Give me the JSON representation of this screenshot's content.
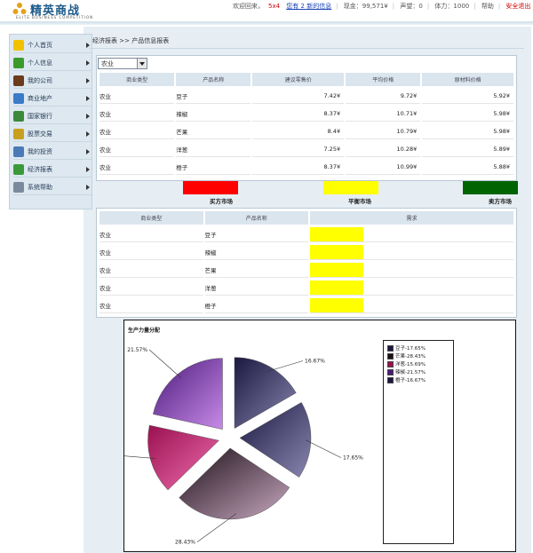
{
  "header": {
    "logo_text": "精英商战",
    "logo_sub": "ELITE BUSINESS COMPETITION",
    "welcome": "欢迎回来，",
    "username": "5x4",
    "messages": "您有 2 新的信息",
    "cash": "现金：99,571¥",
    "reputation": "声望：0",
    "stamina": "体力：1000",
    "help": "帮助",
    "logout": "安全退出"
  },
  "sidebar": {
    "items": [
      {
        "label": "个人首页",
        "icon": "smiley-icon",
        "color": "#f2c200"
      },
      {
        "label": "个人信息",
        "icon": "user-icon",
        "color": "#3a9a2a"
      },
      {
        "label": "我的公司",
        "icon": "door-icon",
        "color": "#6b3b1b"
      },
      {
        "label": "商业地产",
        "icon": "globe-icon",
        "color": "#3a7bc8"
      },
      {
        "label": "国家银行",
        "icon": "money-icon",
        "color": "#3a8a3a"
      },
      {
        "label": "股票交易",
        "icon": "stock-icon",
        "color": "#c8a020"
      },
      {
        "label": "我的投资",
        "icon": "invest-icon",
        "color": "#4a7ab8"
      },
      {
        "label": "经济报表",
        "icon": "chart-icon",
        "color": "#3a9a3a"
      },
      {
        "label": "系统帮助",
        "icon": "help-icon",
        "color": "#7a8a9a"
      }
    ]
  },
  "breadcrumb": {
    "root": "经济报表",
    "sep": ">>",
    "current": "产品信息报表"
  },
  "category_select": {
    "value": "农业"
  },
  "price_table": {
    "headers": [
      "商业类型",
      "产品名称",
      "建议零售价",
      "平均价格",
      "原材料价格"
    ],
    "rows": [
      [
        "农业",
        "豆子",
        "7.42¥",
        "9.72¥",
        "5.92¥"
      ],
      [
        "农业",
        "辣椒",
        "8.37¥",
        "10.71¥",
        "5.98¥"
      ],
      [
        "农业",
        "芒果",
        "8.4¥",
        "10.79¥",
        "5.98¥"
      ],
      [
        "农业",
        "洋葱",
        "7.25¥",
        "10.28¥",
        "5.89¥"
      ],
      [
        "农业",
        "橙子",
        "8.37¥",
        "10.99¥",
        "5.88¥"
      ]
    ]
  },
  "market_legend": [
    {
      "label": "买方市场",
      "color": "#ff0000"
    },
    {
      "label": "平衡市场",
      "color": "#ffff00"
    },
    {
      "label": "卖方市场",
      "color": "#006400"
    }
  ],
  "demand_table": {
    "headers": [
      "商业类型",
      "产品名称",
      "需求"
    ],
    "rows": [
      [
        "农业",
        "豆子"
      ],
      [
        "农业",
        "辣椒"
      ],
      [
        "农业",
        "芒果"
      ],
      [
        "农业",
        "洋葱"
      ],
      [
        "农业",
        "橙子"
      ]
    ],
    "demand_color": "#ffff00"
  },
  "chart_data": {
    "type": "pie",
    "title": "生产力量分配",
    "labels": [
      "豆子",
      "芒果",
      "洋葱",
      "辣椒",
      "橙子"
    ],
    "values": [
      17.65,
      28.43,
      15.69,
      21.57,
      16.67
    ],
    "value_labels": [
      "17.65%",
      "28.43%",
      "15.69%",
      "21.57%",
      "16.67%"
    ],
    "legend_entries": [
      "豆子-17.65%",
      "芒果-28.43%",
      "洋葱-15.69%",
      "辣椒-21.57%",
      "橙子-16.67%"
    ],
    "colors": [
      "#2a2458",
      "#3a2430",
      "#c8206a",
      "#7a2aa0",
      "#2a2458"
    ],
    "legend_position": "right"
  }
}
